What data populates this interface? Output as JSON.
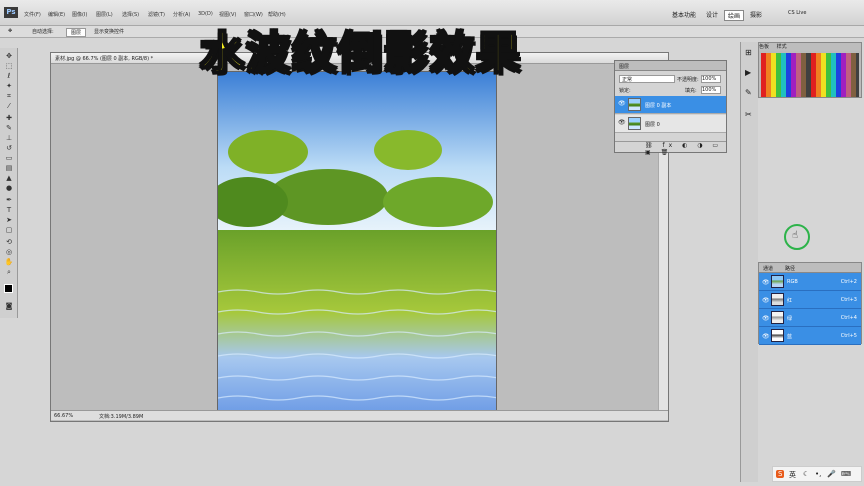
{
  "app": {
    "logo": "Ps"
  },
  "menu": [
    "文件(F)",
    "编辑(E)",
    "图像(I)",
    "图层(L)",
    "选择(S)",
    "滤镜(T)",
    "分析(A)",
    "3D(D)",
    "视图(V)",
    "窗口(W)",
    "帮助(H)"
  ],
  "workspace": {
    "essentials": "基本功能",
    "design": "设计",
    "active": "绘画",
    "photo": "摄影",
    "cslive": "CS Live"
  },
  "options": {
    "autoselect": "自动选择:",
    "group": "图层",
    "transform": "显示变换控件"
  },
  "document": {
    "tab": "素材.jpg @ 66.7% (图层 0 副本, RGB/8) *",
    "zoom": "66.67%",
    "docsize": "文档:3.19M/3.89M"
  },
  "overlay_title": "水波纹倒影效果",
  "layers_panel": {
    "tab": "图层",
    "blend": "正常",
    "opacity_label": "不透明度:",
    "opacity": "100%",
    "lock_label": "锁定:",
    "fill_label": "填充:",
    "fill": "100%",
    "layers": [
      {
        "name": "图层 0 副本"
      },
      {
        "name": "图层 0"
      }
    ]
  },
  "swatch_tabs": {
    "color": "色板",
    "styles": "样式"
  },
  "channels_panel": {
    "tab": "通道",
    "paths": "路径",
    "channels": [
      {
        "name": "RGB",
        "shortcut": "Ctrl+2"
      },
      {
        "name": "红",
        "shortcut": "Ctrl+3"
      },
      {
        "name": "绿",
        "shortcut": "Ctrl+4"
      },
      {
        "name": "蓝",
        "shortcut": "Ctrl+5"
      }
    ]
  },
  "taskbar": {
    "ime": "英"
  }
}
